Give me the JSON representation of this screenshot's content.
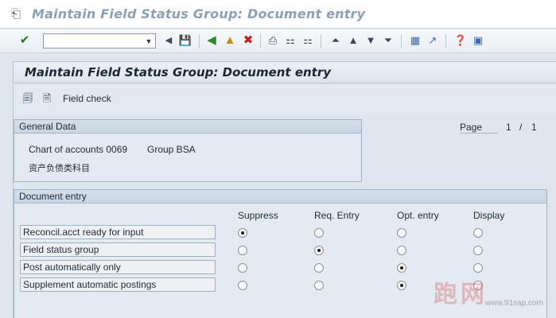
{
  "window": {
    "title": "Maintain Field Status Group: Document entry"
  },
  "toolbar": {
    "command_value": "",
    "icons": [
      "enter-check-icon",
      "save-icon",
      "back-icon",
      "exit-icon",
      "cancel-icon",
      "print-icon",
      "find-icon",
      "find-next-icon",
      "first-page-icon",
      "previous-page-icon",
      "next-page-icon",
      "last-page-icon",
      "create-session-icon",
      "shortcut-icon",
      "help-icon",
      "customize-layout-icon"
    ]
  },
  "app": {
    "title": "Maintain Field Status Group: Document entry",
    "field_check_label": "Field check"
  },
  "general_data": {
    "heading": "General Data",
    "chart_of_accounts": "Chart of accounts 0069",
    "group": "Group BSA",
    "group_text": "资产负债类科目"
  },
  "pager": {
    "label": "Page",
    "current": "1",
    "separator": "/",
    "total": "1"
  },
  "document_entry": {
    "heading": "Document entry",
    "columns": [
      "Suppress",
      "Req. Entry",
      "Opt. entry",
      "Display"
    ],
    "rows": [
      {
        "label": "Reconcil.acct ready for input",
        "selected": 0
      },
      {
        "label": "Field status group",
        "selected": 1
      },
      {
        "label": "Post automatically only",
        "selected": 2
      },
      {
        "label": "Supplement automatic postings",
        "selected": 2
      }
    ]
  },
  "watermark": {
    "logo_text": "跑网",
    "url": "www.91sap.com"
  }
}
